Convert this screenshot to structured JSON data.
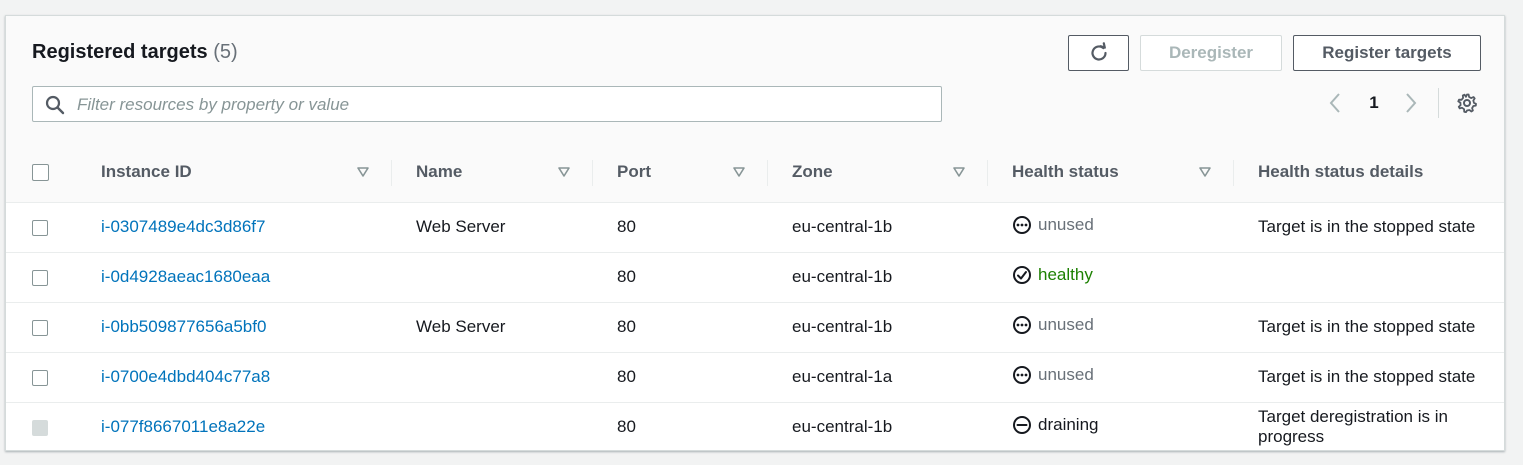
{
  "header": {
    "title": "Registered targets",
    "count": "(5)",
    "deregister_label": "Deregister",
    "register_label": "Register targets",
    "refresh_icon": "refresh-icon",
    "settings_icon": "gear-icon"
  },
  "search": {
    "placeholder": "Filter resources by property or value",
    "value": ""
  },
  "pagination": {
    "current_page": "1"
  },
  "columns": [
    "Instance ID",
    "Name",
    "Port",
    "Zone",
    "Health status",
    "Health status details"
  ],
  "rows": [
    {
      "instance_id": "i-0307489e4dc3d86f7",
      "name": "Web Server",
      "port": "80",
      "zone": "eu-central-1b",
      "status": "unused",
      "details": "Target is in the stopped state",
      "checkbox_disabled": false
    },
    {
      "instance_id": "i-0d4928aeac1680eaa",
      "name": "",
      "port": "80",
      "zone": "eu-central-1b",
      "status": "healthy",
      "details": "",
      "checkbox_disabled": false
    },
    {
      "instance_id": "i-0bb509877656a5bf0",
      "name": "Web Server",
      "port": "80",
      "zone": "eu-central-1b",
      "status": "unused",
      "details": "Target is in the stopped state",
      "checkbox_disabled": false
    },
    {
      "instance_id": "i-0700e4dbd404c77a8",
      "name": "",
      "port": "80",
      "zone": "eu-central-1a",
      "status": "unused",
      "details": "Target is in the stopped state",
      "checkbox_disabled": false
    },
    {
      "instance_id": "i-077f8667011e8a22e",
      "name": "",
      "port": "80",
      "zone": "eu-central-1b",
      "status": "draining",
      "details": "Target deregistration is in progress",
      "checkbox_disabled": true
    }
  ],
  "colors": {
    "link": "#0073bb",
    "healthy": "#1d8102",
    "unused": "#687078"
  }
}
